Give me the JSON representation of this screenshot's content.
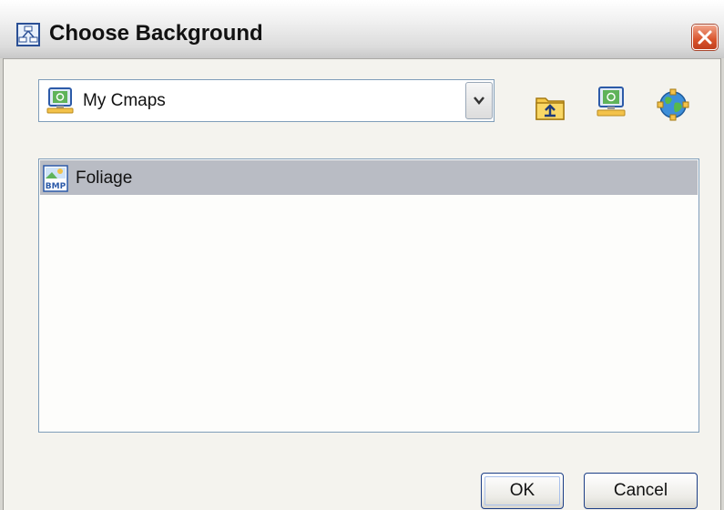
{
  "window": {
    "title": "Choose Background",
    "icons": {
      "title": "cmap-app-icon",
      "close": "close-icon"
    }
  },
  "location": {
    "selected": "My Cmaps",
    "icon": "computer-icon",
    "toolbar": [
      "up-folder-icon",
      "desktop-icon",
      "network-globe-icon"
    ]
  },
  "files": [
    {
      "name": "Foliage",
      "icon": "bmp-file-icon",
      "selected": true
    }
  ],
  "buttons": {
    "ok": "OK",
    "cancel": "Cancel"
  },
  "colors": {
    "selection": "#b9bcc4",
    "default_button_border": "#1c3e86",
    "close_red": "#d9532b"
  }
}
